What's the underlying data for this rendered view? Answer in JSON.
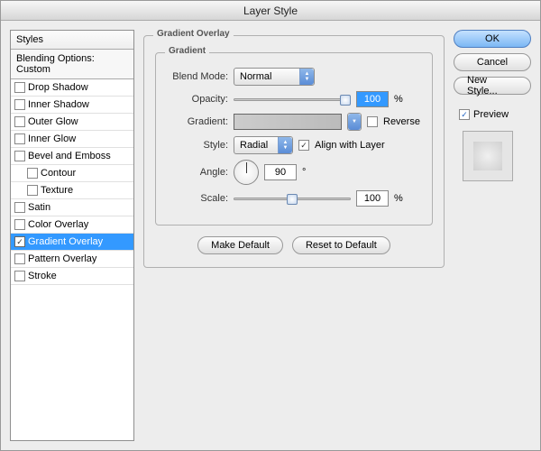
{
  "title": "Layer Style",
  "sidebar": {
    "header": "Styles",
    "blending": "Blending Options: Custom",
    "items": [
      {
        "label": "Drop Shadow",
        "checked": false,
        "selected": false,
        "sub": false
      },
      {
        "label": "Inner Shadow",
        "checked": false,
        "selected": false,
        "sub": false
      },
      {
        "label": "Outer Glow",
        "checked": false,
        "selected": false,
        "sub": false
      },
      {
        "label": "Inner Glow",
        "checked": false,
        "selected": false,
        "sub": false
      },
      {
        "label": "Bevel and Emboss",
        "checked": false,
        "selected": false,
        "sub": false
      },
      {
        "label": "Contour",
        "checked": false,
        "selected": false,
        "sub": true
      },
      {
        "label": "Texture",
        "checked": false,
        "selected": false,
        "sub": true
      },
      {
        "label": "Satin",
        "checked": false,
        "selected": false,
        "sub": false
      },
      {
        "label": "Color Overlay",
        "checked": false,
        "selected": false,
        "sub": false
      },
      {
        "label": "Gradient Overlay",
        "checked": true,
        "selected": true,
        "sub": false
      },
      {
        "label": "Pattern Overlay",
        "checked": false,
        "selected": false,
        "sub": false
      },
      {
        "label": "Stroke",
        "checked": false,
        "selected": false,
        "sub": false
      }
    ]
  },
  "panel": {
    "title": "Gradient Overlay",
    "groupTitle": "Gradient",
    "blendModeLabel": "Blend Mode:",
    "blendMode": "Normal",
    "opacityLabel": "Opacity:",
    "opacity": "100",
    "opacityUnit": "%",
    "gradientLabel": "Gradient:",
    "reverseLabel": "Reverse",
    "reverseChecked": false,
    "styleLabel": "Style:",
    "style": "Radial",
    "alignLabel": "Align with Layer",
    "alignChecked": true,
    "angleLabel": "Angle:",
    "angle": "90",
    "angleUnit": "°",
    "scaleLabel": "Scale:",
    "scale": "100",
    "scaleUnit": "%",
    "makeDefault": "Make Default",
    "resetDefault": "Reset to Default"
  },
  "buttons": {
    "ok": "OK",
    "cancel": "Cancel",
    "newStyle": "New Style...",
    "previewLabel": "Preview",
    "previewChecked": true
  }
}
